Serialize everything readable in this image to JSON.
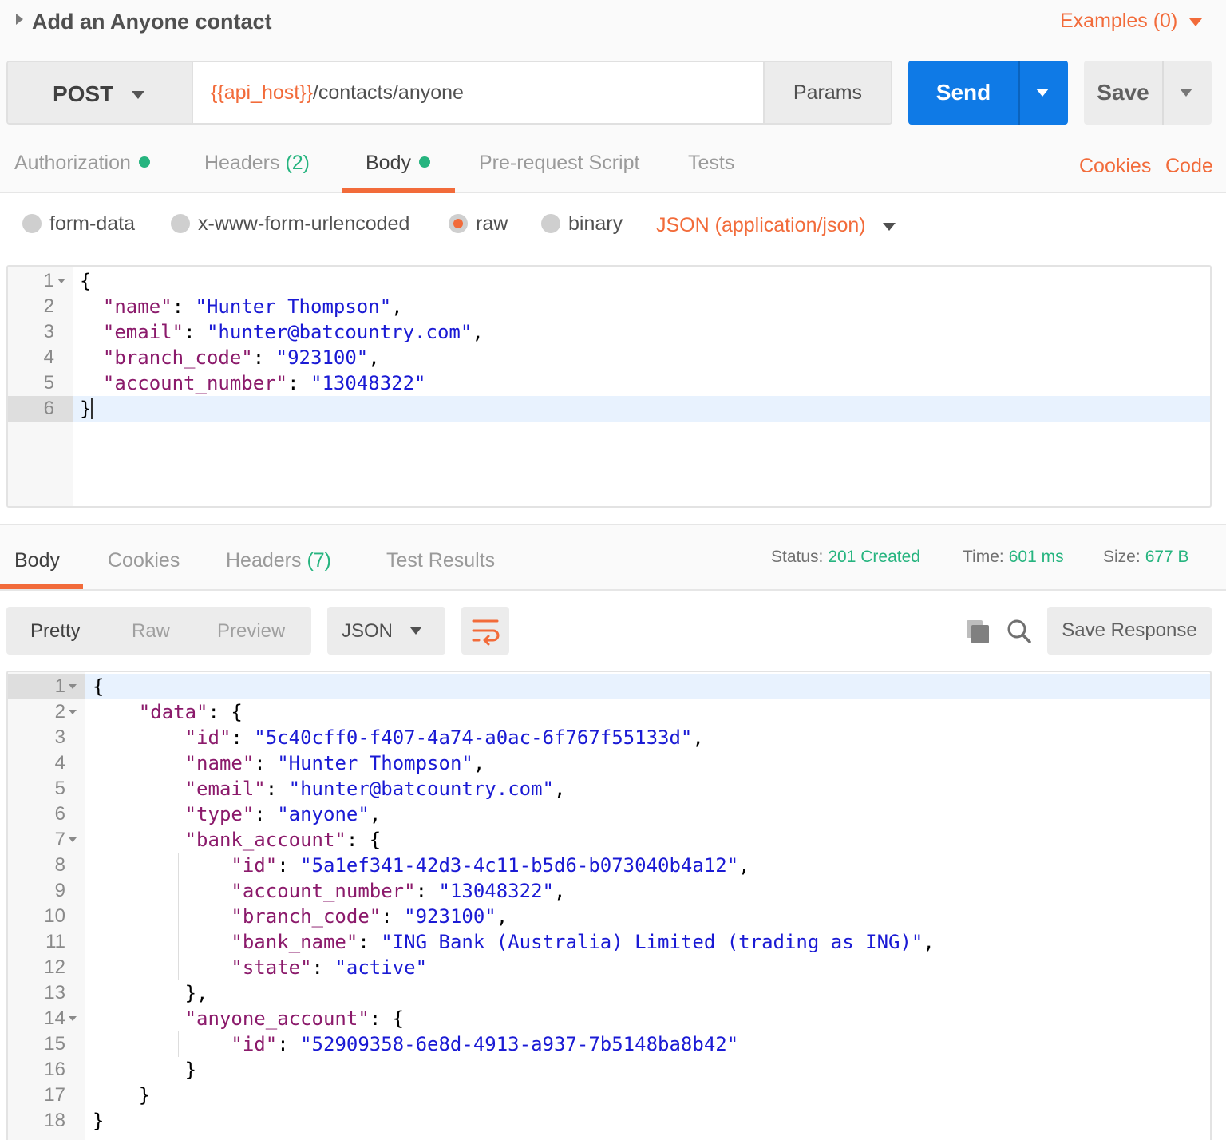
{
  "request": {
    "title": "Add an Anyone contact",
    "examples_label": "Examples (0)",
    "method": "POST",
    "url_variable": "{{api_host}}",
    "url_path": "/contacts/anyone",
    "params_label": "Params",
    "send_label": "Send",
    "save_label": "Save"
  },
  "request_tabs": {
    "authorization": "Authorization",
    "headers": "Headers",
    "headers_count": "(2)",
    "body": "Body",
    "prerequest": "Pre-request Script",
    "tests": "Tests",
    "cookies": "Cookies",
    "code": "Code",
    "active": "Body"
  },
  "body_types": {
    "options": [
      "form-data",
      "x-www-form-urlencoded",
      "raw",
      "binary"
    ],
    "selected": "raw",
    "content_type": "JSON (application/json)"
  },
  "request_body": [
    "{",
    "  \"name\": \"Hunter Thompson\",",
    "  \"email\": \"hunter@batcountry.com\",",
    "  \"branch_code\": \"923100\",",
    "  \"account_number\": \"13048322\"",
    "}"
  ],
  "response_tabs": {
    "body": "Body",
    "cookies": "Cookies",
    "headers": "Headers",
    "headers_count": "(7)",
    "test_results": "Test Results",
    "active": "Body"
  },
  "response_meta": {
    "status_label": "Status:",
    "status_value": "201 Created",
    "time_label": "Time:",
    "time_value": "601 ms",
    "size_label": "Size:",
    "size_value": "677 B"
  },
  "response_toolbar": {
    "view_modes": [
      "Pretty",
      "Raw",
      "Preview"
    ],
    "active_view": "Pretty",
    "format": "JSON",
    "save_response": "Save Response"
  },
  "response_body": [
    "{",
    "    \"data\": {",
    "        \"id\": \"5c40cff0-f407-4a74-a0ac-6f767f55133d\",",
    "        \"name\": \"Hunter Thompson\",",
    "        \"email\": \"hunter@batcountry.com\",",
    "        \"type\": \"anyone\",",
    "        \"bank_account\": {",
    "            \"id\": \"5a1ef341-42d3-4c11-b5d6-b073040b4a12\",",
    "            \"account_number\": \"13048322\",",
    "            \"branch_code\": \"923100\",",
    "            \"bank_name\": \"ING Bank (Australia) Limited (trading as ING)\",",
    "            \"state\": \"active\"",
    "        },",
    "        \"anyone_account\": {",
    "            \"id\": \"52909358-6e8d-4913-a937-7b5148ba8b42\"",
    "        }",
    "    }",
    "}"
  ],
  "colors": {
    "accent": "#f26b3a",
    "send": "#0f7ae6",
    "status_ok": "#26b47f",
    "json_key": "#8b1a6b",
    "json_string": "#1a1ad4"
  }
}
